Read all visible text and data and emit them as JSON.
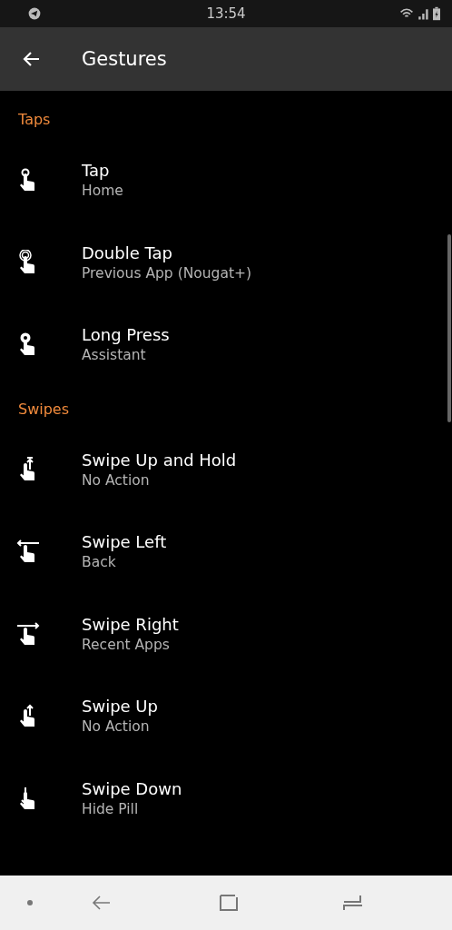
{
  "status_bar": {
    "time": "13:54"
  },
  "app_bar": {
    "title": "Gestures"
  },
  "sections": [
    {
      "header": "Taps",
      "items": [
        {
          "kind": "tap",
          "title": "Tap",
          "value": "Home"
        },
        {
          "kind": "double-tap",
          "title": "Double Tap",
          "value": "Previous App (Nougat+)"
        },
        {
          "kind": "long-press",
          "title": "Long Press",
          "value": "Assistant"
        }
      ]
    },
    {
      "header": "Swipes",
      "items": [
        {
          "kind": "swipe-up-hold",
          "title": "Swipe Up and Hold",
          "value": "No Action"
        },
        {
          "kind": "swipe-left",
          "title": "Swipe Left",
          "value": "Back"
        },
        {
          "kind": "swipe-right",
          "title": "Swipe Right",
          "value": "Recent Apps"
        },
        {
          "kind": "swipe-up",
          "title": "Swipe Up",
          "value": "No Action"
        },
        {
          "kind": "swipe-down",
          "title": "Swipe Down",
          "value": "Hide Pill"
        }
      ]
    }
  ]
}
